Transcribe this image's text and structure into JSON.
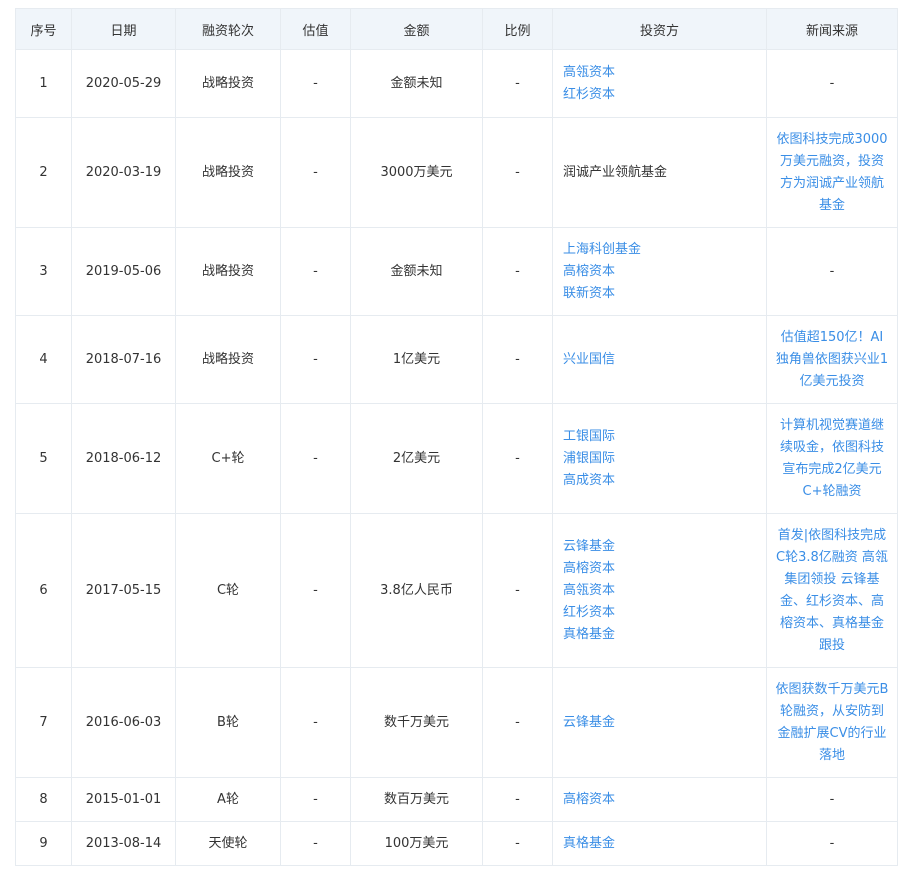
{
  "headers": [
    "序号",
    "日期",
    "融资轮次",
    "估值",
    "金额",
    "比例",
    "投资方",
    "新闻来源"
  ],
  "rows": [
    {
      "no": "1",
      "date": "2020-05-29",
      "round": "战略投资",
      "valuation": "-",
      "amount": "金额未知",
      "ratio": "-",
      "investors": [
        "高瓴资本",
        "红杉资本"
      ],
      "news": "-",
      "news_is_link": false
    },
    {
      "no": "2",
      "date": "2020-03-19",
      "round": "战略投资",
      "valuation": "-",
      "amount": "3000万美元",
      "ratio": "-",
      "investors": [
        "润诚产业领航基金"
      ],
      "investors_plain": true,
      "news": "依图科技完成3000万美元融资，投资方为润诚产业领航基金",
      "news_is_link": true
    },
    {
      "no": "3",
      "date": "2019-05-06",
      "round": "战略投资",
      "valuation": "-",
      "amount": "金额未知",
      "ratio": "-",
      "investors": [
        "上海科创基金",
        "高榕资本",
        "联新资本"
      ],
      "news": "-",
      "news_is_link": false
    },
    {
      "no": "4",
      "date": "2018-07-16",
      "round": "战略投资",
      "valuation": "-",
      "amount": "1亿美元",
      "ratio": "-",
      "investors": [
        "兴业国信"
      ],
      "news": "估值超150亿！AI独角兽依图获兴业1亿美元投资",
      "news_is_link": true
    },
    {
      "no": "5",
      "date": "2018-06-12",
      "round": "C+轮",
      "valuation": "-",
      "amount": "2亿美元",
      "ratio": "-",
      "investors": [
        "工银国际",
        "浦银国际",
        "高成资本"
      ],
      "news": "计算机视觉赛道继续吸金，依图科技宣布完成2亿美元C+轮融资",
      "news_is_link": true
    },
    {
      "no": "6",
      "date": "2017-05-15",
      "round": "C轮",
      "valuation": "-",
      "amount": "3.8亿人民币",
      "ratio": "-",
      "investors": [
        "云锋基金",
        "高榕资本",
        "高瓴资本",
        "红杉资本",
        "真格基金"
      ],
      "news": "首发|依图科技完成C轮3.8亿融资 高瓴集团领投 云锋基金、红杉资本、高榕资本、真格基金跟投",
      "news_is_link": true
    },
    {
      "no": "7",
      "date": "2016-06-03",
      "round": "B轮",
      "valuation": "-",
      "amount": "数千万美元",
      "ratio": "-",
      "investors": [
        "云锋基金"
      ],
      "news": "依图获数千万美元B轮融资，从安防到金融扩展CV的行业落地",
      "news_is_link": true
    },
    {
      "no": "8",
      "date": "2015-01-01",
      "round": "A轮",
      "valuation": "-",
      "amount": "数百万美元",
      "ratio": "-",
      "investors": [
        "高榕资本"
      ],
      "news": "-",
      "news_is_link": false
    },
    {
      "no": "9",
      "date": "2013-08-14",
      "round": "天使轮",
      "valuation": "-",
      "amount": "100万美元",
      "ratio": "-",
      "investors": [
        "真格基金"
      ],
      "news": "-",
      "news_is_link": false
    }
  ]
}
